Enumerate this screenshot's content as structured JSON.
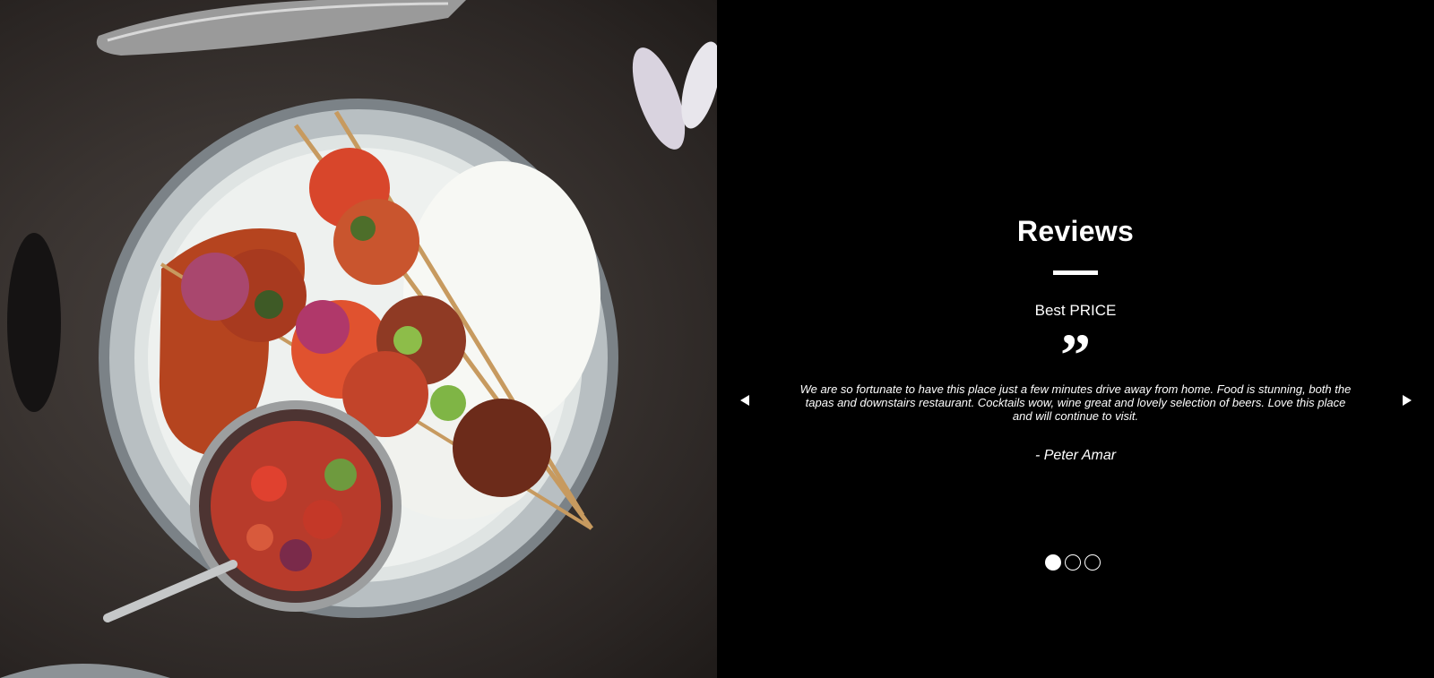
{
  "hero_image": {
    "icon": "food-plate-image"
  },
  "reviews": {
    "title": "Reviews",
    "subtitle": "Best PRICE",
    "quote_mark": "”",
    "items": [
      {
        "text": "We are so fortunate to have this place just a few minutes drive away from home. Food is stunning, both the tapas and downstairs restaurant. Cocktails wow, wine great and lovely selection of beers. Love this place and will continue to visit.",
        "author": "- Peter Amar"
      }
    ],
    "prev_icon": "triangle-left-icon",
    "next_icon": "triangle-right-icon",
    "pagination": {
      "count": 3,
      "active_index": 0
    }
  }
}
